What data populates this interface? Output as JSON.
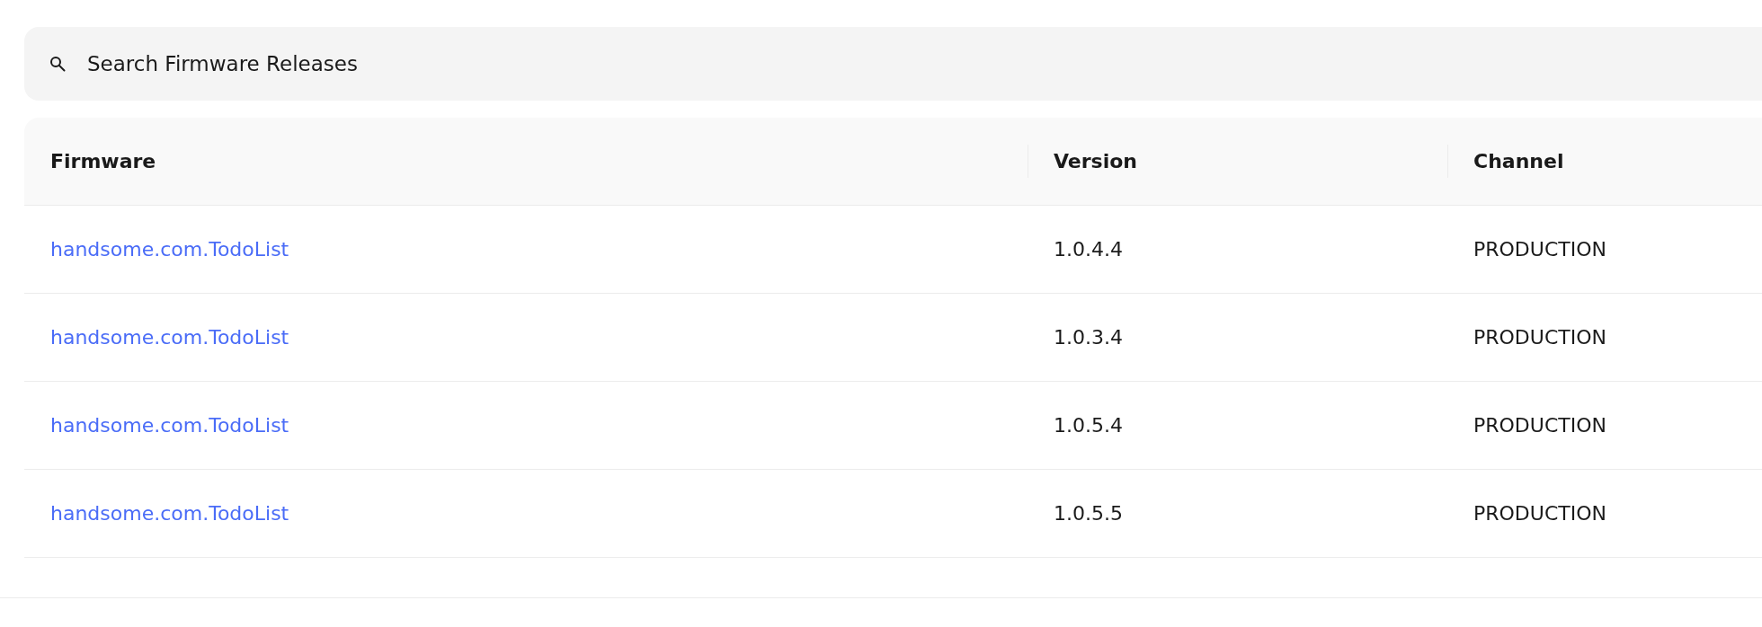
{
  "search": {
    "placeholder": "Search Firmware Releases"
  },
  "table": {
    "columns": [
      "Firmware",
      "Version",
      "Channel"
    ],
    "rows": [
      {
        "firmware": "handsome.com.TodoList",
        "version": "1.0.4.4",
        "channel": "PRODUCTION"
      },
      {
        "firmware": "handsome.com.TodoList",
        "version": "1.0.3.4",
        "channel": "PRODUCTION"
      },
      {
        "firmware": "handsome.com.TodoList",
        "version": "1.0.5.4",
        "channel": "PRODUCTION"
      },
      {
        "firmware": "handsome.com.TodoList",
        "version": "1.0.5.5",
        "channel": "PRODUCTION"
      }
    ]
  }
}
